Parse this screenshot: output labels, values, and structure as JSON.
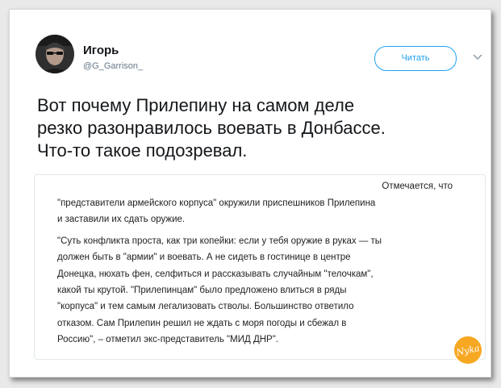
{
  "tweet": {
    "author": {
      "name": "Игорь",
      "handle": "@G_Garrison_"
    },
    "follow_label": "Читать",
    "text_lines": [
      "Вот почему Прилепину на самом деле",
      "резко разонравилось воевать в Донбассе.",
      "Что-то такое подозревал."
    ]
  },
  "quoted_article": {
    "lines": [
      "Отмечается, что",
      "\"представители армейского корпуса\" окружили приспешников Прилепина",
      "и заставили их сдать оружие.",
      "\"Суть конфликта проста, как три копейки: если у тебя оружие в руках — ты",
      "должен быть в \"армии\" и воевать. А не сидеть в гостинице в центре",
      "Донецка, нюхать фен, селфиться и рассказывать случайным \"телочкам\",",
      "какой ты крутой. \"Прилепинцам\" было предложено влиться в ряды",
      "\"корпуса\" и тем самым легализовать стволы. Большинство ответило",
      "отказом. Сам Прилепин решил не ждать с моря погоды и сбежал в",
      "Россию\", – отметил экс-представитель \"МИД ДНР\"."
    ]
  },
  "watermark": {
    "text": "Nyka"
  },
  "colors": {
    "accent": "#1da1f2",
    "text": "#14171a",
    "muted": "#657786",
    "badge": "#f7a823"
  }
}
